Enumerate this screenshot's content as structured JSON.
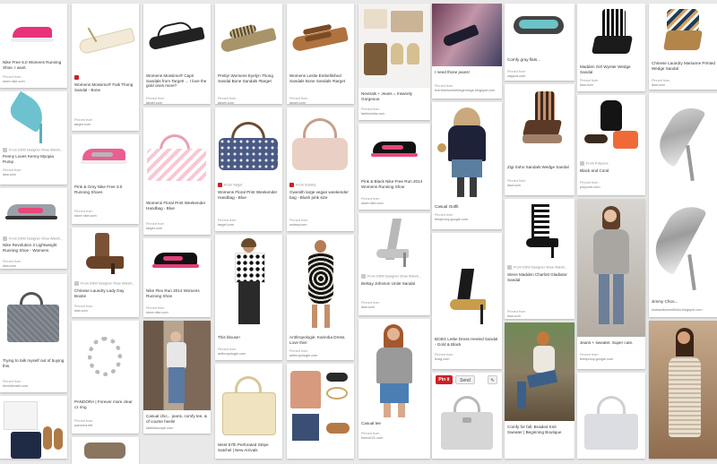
{
  "hover_actions": {
    "pin_it": "Pin it",
    "send": "Send",
    "edit": "✎"
  },
  "pins": [
    {
      "desc": "Nike Free 5.0 Womens Running Shoe. I want.",
      "src_label": "Pinned from",
      "src": "store.nike.com"
    },
    {
      "desc": "Womens Mossimo® Faik Thong Sandal - Bone",
      "src_label": "Pinned from",
      "src": "target.com"
    },
    {
      "desc": "Womens Mossimo® Capri Sandals from Target! ... I love the gold ones more?",
      "src_label": "Pinned from",
      "src": "target.com"
    },
    {
      "desc": "Pretty! Womens Eyelyn Thong Sandal Bone Sandals #target",
      "src_label": "Pinned from",
      "src": "target.com"
    },
    {
      "desc": "Womens Leslie Embellished Sandals Bone Sandals #target",
      "src_label": "Pinned from",
      "src": "target.com"
    },
    {
      "desc": "Neutrals + Jeans = Insanely Gorgeous.",
      "src_label": "Pinned from",
      "src": "fashionista.com"
    },
    {
      "desc": "I need those jeans!",
      "src_label": "Pinned from",
      "src": "fromthehumblebeginnings.blogspot.com"
    },
    {
      "desc": "Comfy gray flats...",
      "src_label": "Pinned from",
      "src": "zappos.com"
    },
    {
      "desc": "Madden Girl Wynter Wedge Sandal",
      "src_label": "Pinned from",
      "src": "dsw.com"
    },
    {
      "desc": "Chinese Laundry Marianne Printed Wedge Sandal",
      "src_label": "Pinned from",
      "src": "dsw.com"
    },
    {
      "desc": "Penny Loves Kenny Myopia Pump",
      "src_label": "Pinned from",
      "src": "dsw.com",
      "repin": "From DSW Designer Shoe Wareh..."
    },
    {
      "desc": "Womens Mossimo® Pearl Thong Sandal - Bone #target",
      "src_label": "Pinned from",
      "src": "target.com"
    },
    {
      "desc": "Pink & Grey Nike Free 3.0 Running Shoes",
      "src_label": "Pinned from",
      "src": "store.nike.com"
    },
    {
      "desc": "Womens Floral Print Weekender Handbag - Blue",
      "src_label": "Pinned from",
      "src": "target.com",
      "repin": "From Target"
    },
    {
      "desc": "Gwenith large vegan weekender bag - Blush pink size",
      "src_label": "Pinned from",
      "src": "wolsey.com",
      "repin": "From Society"
    },
    {
      "desc": "Pink & Black Nike Free Run 2014 Womens Running Shoe",
      "src_label": "Pinned from",
      "src": "store.nike.com"
    },
    {
      "desc": "Casual Outfit",
      "src_label": "Pinned from",
      "src": "feedproxy.google.com"
    },
    {
      "desc": "Zigi Soho Sandals Wedge Sandal",
      "src_label": "Pinned from",
      "src": "dsw.com"
    },
    {
      "desc": "Black and Coral",
      "src_label": "Pinned from",
      "src": "polyvore.com",
      "repin": "From Polyvore"
    },
    {
      "desc": "Nike Revolution 2 Lightweight Running Shoe - Womens",
      "src_label": "Pinned from",
      "src": "dsw.com",
      "repin": "From DSW Designer Shoe Wareh..."
    },
    {
      "desc": "Chinese Laundry Lady Day Bootie",
      "src_label": "Pinned from",
      "src": "dsw.com",
      "repin": "From DSW Designer Shoe Wareh..."
    },
    {
      "desc": "Nike Flex Run 2014 Womens Running Shoe",
      "src_label": "Pinned from",
      "src": "store.nike.com"
    },
    {
      "desc": "Steve Madden Charlott Gladiator Sandal",
      "src_label": "Pinned from",
      "src": "dsw.com",
      "repin": "From DSW Designer Shoe Wareh..."
    },
    {
      "desc": "Jimmy Choo...",
      "src_label": "Pinned from",
      "src": "lookandlovewithlolo.blogspot.com"
    },
    {
      "desc": "Trying to talk myself out of buying this.",
      "src_label": "Pinned from",
      "src": "henribendel.com"
    },
    {
      "desc": "Belsay Johnson Unite Sandal",
      "src_label": "Pinned from",
      "src": "dsw.com",
      "repin": "From DSW Designer Shoe Wareh..."
    },
    {
      "desc": "This blouse!",
      "src_label": "Pinned from",
      "src": "anthropologie.com"
    },
    {
      "desc": "Anthropologie: Karimba Dress. Love this!",
      "src_label": "Pinned from",
      "src": "anthropologie.com"
    },
    {
      "desc": "Jeans + sweater. Super cute.",
      "src_label": "Pinned from",
      "src": "feedproxy.google.com"
    },
    {
      "desc": "BCBG Lettie Dress Heeled Sandal - Gold & Black",
      "src_label": "Pinned from",
      "src": "bcbg.com"
    },
    {
      "desc": "PANDORA | Forever more clear cz ring",
      "src_label": "Pinned from",
      "src": "pandora.net"
    },
    {
      "desc": "Casual chic... jeans, comfy tee, & of course heels!",
      "src_label": "Pinned from",
      "src": "kaleidoscope.com"
    },
    {
      "desc": "Casual tee",
      "src_label": "Pinned from",
      "src": "forever21.com"
    },
    {
      "desc": "Comfy for fall. Braided Knit Sweater | Beginning Boutique",
      "src_label": "Pinned from",
      "src": "feedproxy.google.com"
    },
    {
      "desc": "West 57th Perforated Stripe Satchel | New Arrivals",
      "src_label": "Pinned from",
      "src": "shop.kate.com"
    }
  ]
}
